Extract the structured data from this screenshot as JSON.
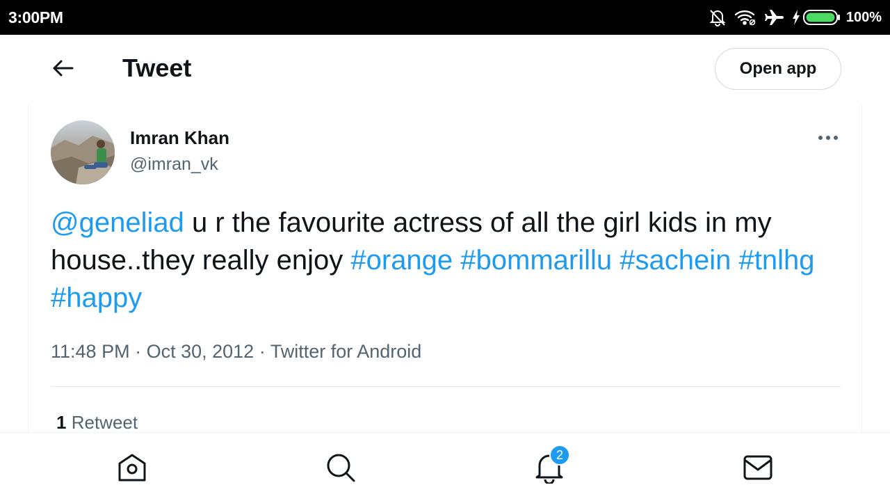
{
  "status_bar": {
    "time": "3:00PM",
    "battery_percent": "100%",
    "icons": [
      "notifications-off-icon",
      "wifi-icon",
      "airplane-mode-icon",
      "charging-icon",
      "battery-icon"
    ]
  },
  "header": {
    "back_icon": "arrow-left-icon",
    "title": "Tweet",
    "open_app_label": "Open app"
  },
  "tweet": {
    "author": {
      "display_name": "Imran Khan",
      "handle": "@imran_vk"
    },
    "more_icon": "more-horizontal-icon",
    "text": {
      "mention": "@geneliad",
      "body": " u r the favourite actress of all the girl kids in my house..they really enjoy ",
      "hashtags": [
        "#orange",
        "#bommarillu",
        "#sachein",
        "#tnlhg",
        "#happy"
      ]
    },
    "time": "11:48 PM",
    "date": "Oct 30, 2012",
    "separator": " · ",
    "source": "Twitter for Android",
    "retweet_count": "1",
    "retweet_label": "Retweet"
  },
  "bottom_nav": {
    "items": [
      "home-icon",
      "search-icon",
      "notifications-icon",
      "messages-icon"
    ],
    "notification_badge": "2"
  },
  "colors": {
    "link": "#1d9bf0",
    "text_primary": "#0f1419",
    "text_secondary": "#536471",
    "status_bar_bg": "#000000",
    "battery_green": "#4cd964"
  }
}
